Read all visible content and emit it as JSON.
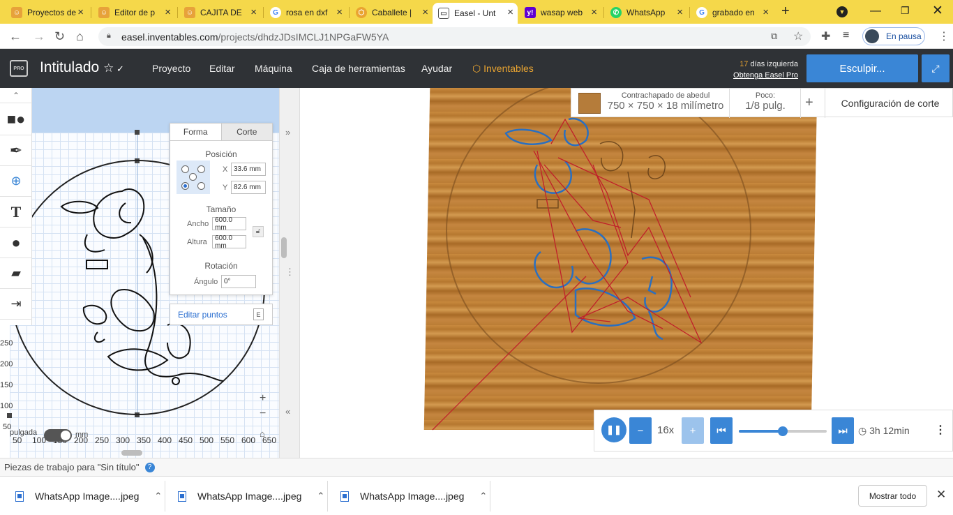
{
  "browser": {
    "tabs": [
      {
        "title": "Proyectos de",
        "icon": "maker-icon",
        "active": false
      },
      {
        "title": "Editor de p",
        "icon": "maker-icon",
        "active": false
      },
      {
        "title": "CAJITA DE",
        "icon": "maker-icon",
        "active": false
      },
      {
        "title": "rosa en dxf",
        "icon": "google-icon",
        "active": false
      },
      {
        "title": "Caballete |",
        "icon": "inventables-icon",
        "active": false
      },
      {
        "title": "Easel - Unt",
        "icon": "easel-icon",
        "active": true
      },
      {
        "title": "wasap web",
        "icon": "yahoo-icon",
        "active": false
      },
      {
        "title": "WhatsApp",
        "icon": "whatsapp-icon",
        "active": false
      },
      {
        "title": "grabado en",
        "icon": "google-icon",
        "active": false
      }
    ],
    "new_tab": "+",
    "url_host": "easel.inventables.com",
    "url_path": "/projects/dhdzJDsIMCLJ1NPGaFW5YA",
    "profile_status": "En pausa"
  },
  "app": {
    "logo_text": "PRO",
    "project_title": "Intitulado",
    "menu": [
      "Proyecto",
      "Editar",
      "Máquina",
      "Caja de herramientas",
      "Ayudar"
    ],
    "inventables_label": "Inventables",
    "trial_days": "17",
    "trial_text": "días izquierda",
    "trial_link": "Obtenga Easel Pro",
    "carve_button": "Esculpir..."
  },
  "canvas": {
    "ruler_bottom": [
      "50",
      "100",
      "150",
      "200",
      "250",
      "300",
      "350",
      "400",
      "450",
      "500",
      "550",
      "600",
      "650"
    ],
    "ruler_left": [
      "250",
      "200",
      "150",
      "100",
      "50"
    ],
    "unit_left": "pulgada",
    "unit_right": "mm"
  },
  "properties": {
    "tab_shape": "Forma",
    "tab_cut": "Corte",
    "position_title": "Posición",
    "x_label": "X",
    "x_value": "33.6 mm",
    "y_label": "Y",
    "y_value": "82.6 mm",
    "size_title": "Tamaño",
    "width_label": "Ancho",
    "width_value": "600.0 mm",
    "height_label": "Altura",
    "height_value": "600.0 mm",
    "rotation_title": "Rotación",
    "angle_label": "Ángulo",
    "angle_value": "0°",
    "edit_points": "Editar puntos",
    "edit_points_key": "E"
  },
  "material": {
    "name": "Contrachapado de abedul",
    "dimensions": "750 × 750 × 18 milímetro",
    "bit_label": "Poco:",
    "bit_value": "1/8 pulg.",
    "add": "+",
    "cut_settings": "Configuración de corte"
  },
  "playback": {
    "speed": "16x",
    "progress": 0.5,
    "time": "3h 12min"
  },
  "status": {
    "text": "Piezas de trabajo para \"Sin título\"",
    "help": "?"
  },
  "downloads": {
    "items": [
      "WhatsApp Image....jpeg",
      "WhatsApp Image....jpeg",
      "WhatsApp Image....jpeg"
    ],
    "show_all": "Mostrar todo"
  },
  "colors": {
    "accent": "#3a86d6",
    "header_bg": "#2f3236",
    "tabstrip": "#f5d84a",
    "toolpath_blue": "#2a6fc0",
    "toolpath_red": "#c0202a",
    "inventables_orange": "#e9a431"
  }
}
